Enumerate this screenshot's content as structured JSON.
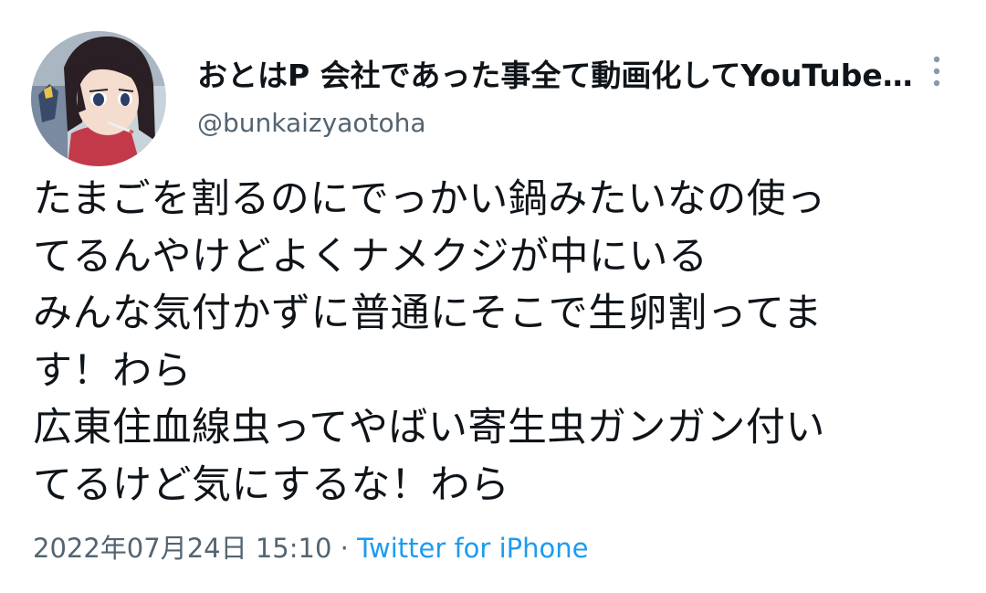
{
  "author": {
    "display_name": "おとはP 会社であった事全て動画化してYouTube…",
    "handle": "@bunkaizyaotoha"
  },
  "tweet": {
    "lines": [
      "たまごを割るのにでっかい鍋みたいなの使っ",
      "てるんやけどよくナメクジが中にいる",
      "みんな気付かずに普通にそこで生卵割ってま",
      "す！わら",
      "広東住血線虫ってやばい寄生虫ガンガン付い",
      "てるけど気にするな！わら"
    ]
  },
  "meta": {
    "timestamp": "2022年07月24日 15:10",
    "separator": "·",
    "source": "Twitter for iPhone"
  },
  "icons": {
    "more": "more-vertical-icon"
  },
  "colors": {
    "text": "#0f1419",
    "secondary": "#536471",
    "link": "#1d9bf0"
  }
}
